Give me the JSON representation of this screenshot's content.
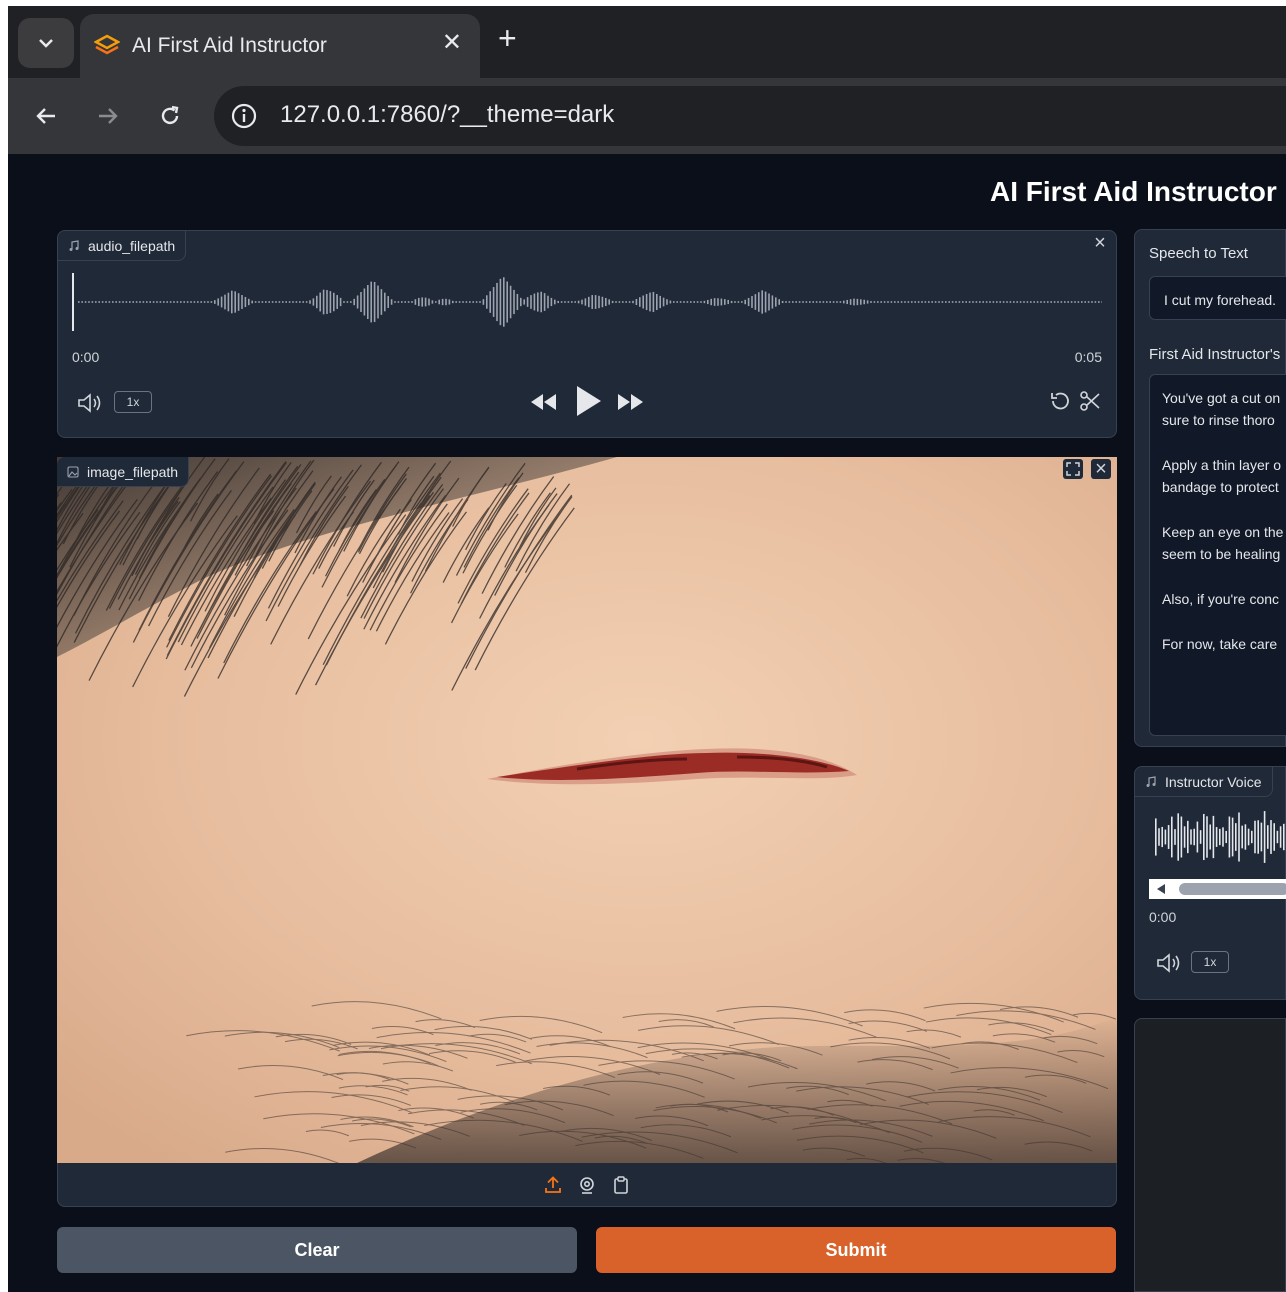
{
  "browser": {
    "tab_title": "AI First Aid Instructor",
    "url": "127.0.0.1:7860/?__theme=dark"
  },
  "app": {
    "title": "AI First Aid Instructor"
  },
  "audio_input": {
    "label": "audio_filepath",
    "time_start": "0:00",
    "time_end": "0:05",
    "speed": "1x"
  },
  "image_input": {
    "label": "image_filepath"
  },
  "buttons": {
    "clear": "Clear",
    "submit": "Submit"
  },
  "speech_to_text": {
    "label": "Speech to Text",
    "value": "I cut my forehead."
  },
  "instructor_response": {
    "label": "First Aid Instructor's",
    "lines": [
      "You've got a cut on",
      "sure to rinse thoro",
      "Apply a thin layer o",
      "bandage to protect",
      "Keep an eye on the",
      "seem to be healing",
      "Also, if you're conc",
      "For now, take care"
    ]
  },
  "instructor_voice": {
    "label": "Instructor Voice",
    "time_start": "0:00",
    "speed": "1x"
  },
  "colors": {
    "accent": "#d9612a",
    "app_bg": "#0b0f19",
    "panel_bg": "#1f2937"
  }
}
